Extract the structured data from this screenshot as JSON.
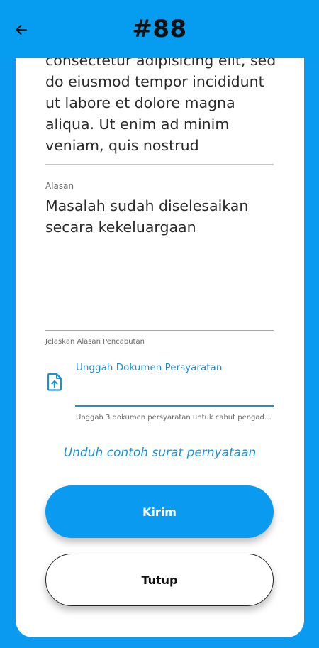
{
  "appbar": {
    "title": "#88",
    "back_icon": "arrow-left-icon"
  },
  "description": {
    "text": "consectetur adipisicing elit, sed do eiusmod tempor incididunt ut labore et dolore magna aliqua. Ut enim ad minim veniam, quis nostrud"
  },
  "reason": {
    "label": "Alasan",
    "value": "Masalah sudah diselesaikan secara kekeluargaan",
    "helper": "Jelaskan Alasan Pencabutan"
  },
  "upload": {
    "icon": "file-upload-icon",
    "title": "Unggah Dokumen Persyaratan",
    "helper": "Unggah 3 dokumen persyaratan untuk cabut pengaduan (.pd..."
  },
  "download_link": "Unduh contoh surat pernyataan",
  "buttons": {
    "submit": "Kirim",
    "close": "Tutup"
  },
  "colors": {
    "primary": "#0a9bf0",
    "link": "#1d8fd6"
  }
}
